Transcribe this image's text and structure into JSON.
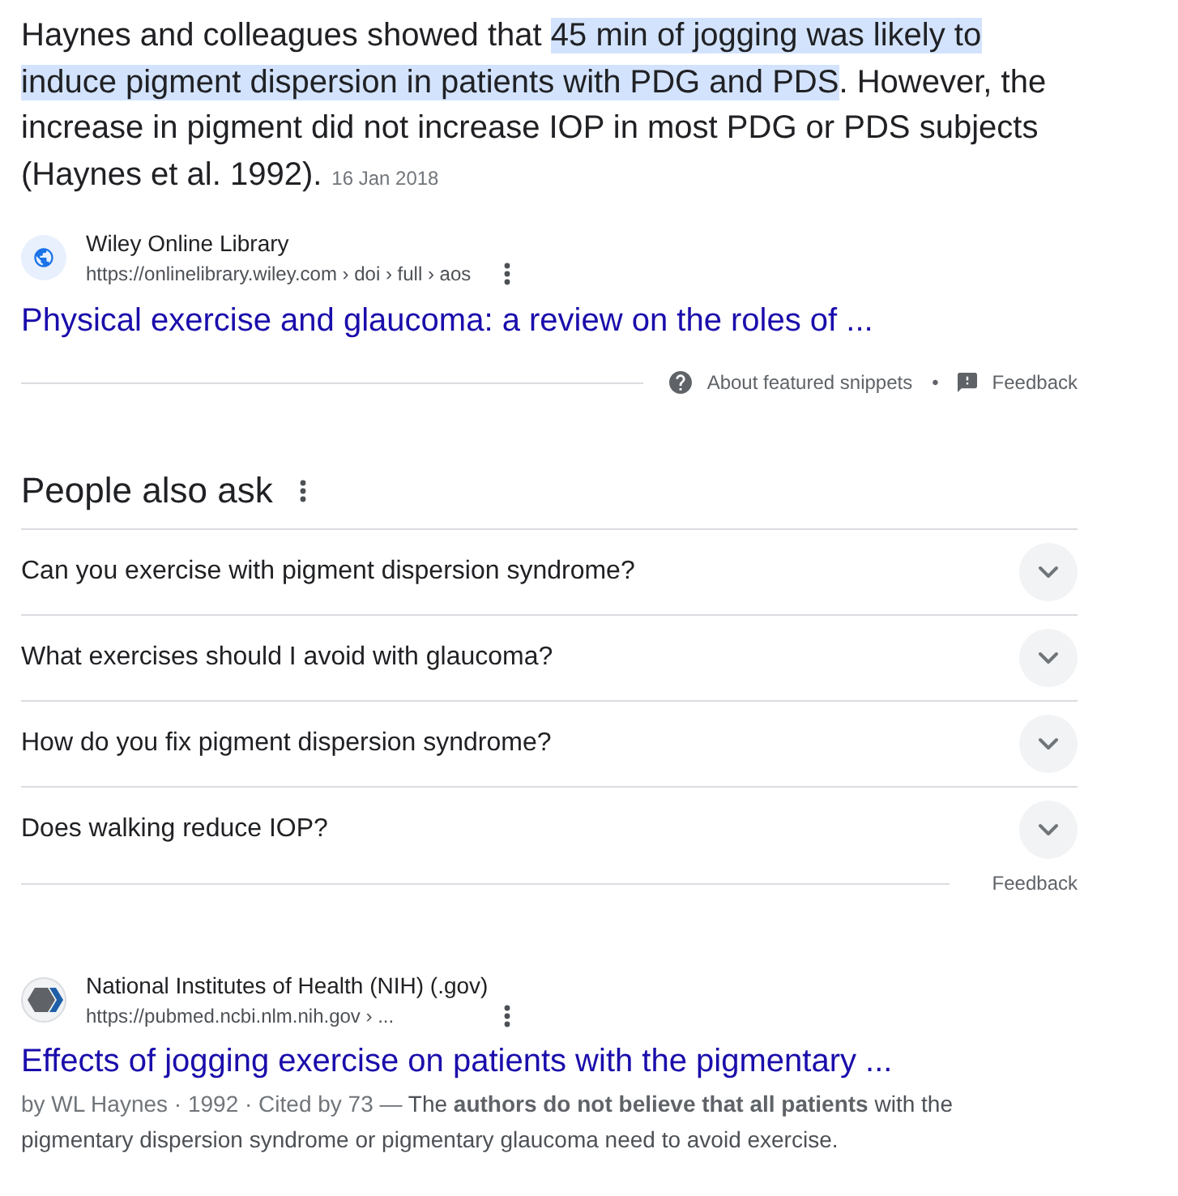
{
  "featured_snippet": {
    "segments": [
      {
        "text": "Haynes and colleagues showed that ",
        "highlighted": false
      },
      {
        "text": "45 min of jogging was likely to induce pigment dispersion in patients with PDG and PDS",
        "highlighted": true
      },
      {
        "text": ". However, the increase in pigment did not increase IOP in most PDG or PDS subjects (Haynes et al. 1992).",
        "highlighted": false
      }
    ],
    "date": "16 Jan 2018",
    "source": {
      "name": "Wiley Online Library",
      "url": "https://onlinelibrary.wiley.com › doi › full › aos"
    },
    "title": "Physical exercise and glaucoma: a review on the roles of ...",
    "footer": {
      "about": "About featured snippets",
      "separator": "•",
      "feedback": "Feedback"
    }
  },
  "people_also_ask": {
    "heading": "People also ask",
    "questions": [
      {
        "text": "Can you exercise with pigment dispersion syndrome?",
        "expanded": false
      },
      {
        "text": "What exercises should I avoid with glaucoma?",
        "expanded": false
      },
      {
        "text": "How do you fix pigment dispersion syndrome?",
        "expanded": false
      },
      {
        "text": "Does walking reduce IOP?",
        "expanded": false
      }
    ],
    "feedback": "Feedback"
  },
  "result": {
    "source": {
      "name": "National Institutes of Health (NIH) (.gov)",
      "url": "https://pubmed.ncbi.nlm.nih.gov › ..."
    },
    "title": "Effects of jogging exercise on patients with the pigmentary ...",
    "byline": "by WL Haynes · 1992 · Cited by 73 — ",
    "snippet": "The **authors do not believe that all patients** with the pigmentary dispersion syndrome or pigmentary glaucoma need to avoid exercise."
  }
}
